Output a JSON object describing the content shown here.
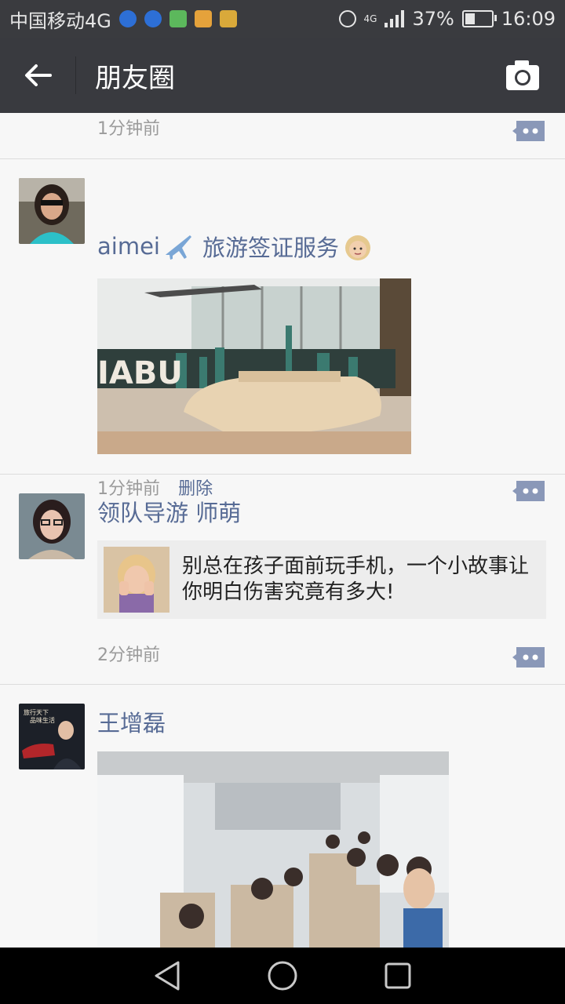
{
  "status_bar": {
    "carrier": "中国移动4G",
    "network": "4G",
    "battery": "37%",
    "time": "16:09"
  },
  "header": {
    "title": "朋友圈"
  },
  "posts": [
    {
      "time": "1分钟前"
    },
    {
      "name": "aimei",
      "name_suffix": "旅游签证服务",
      "time": "1分钟前",
      "delete_label": "删除"
    },
    {
      "name": "领队导游 师萌",
      "share_title": "别总在孩子面前玩手机，一个小故事让你明白伤害究竟有多大!",
      "time": "2分钟前"
    },
    {
      "name": "王增磊",
      "avatar_text_1": "旅行天下",
      "avatar_text_2": "品味生活"
    }
  ],
  "colors": {
    "name_link": "#576b95",
    "title_bar": "#393a3f",
    "status_bar": "#3a3b3f",
    "time_gray": "#9b9b9b"
  }
}
